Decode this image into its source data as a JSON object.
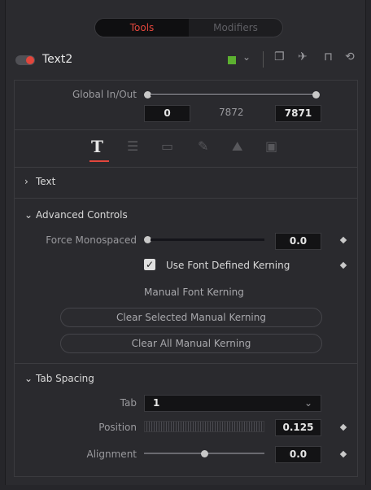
{
  "tabs": {
    "tools": "Tools",
    "modifiers": "Modifiers"
  },
  "header": {
    "tool_name": "Text2",
    "color_chip": "#5cb030"
  },
  "global": {
    "label": "Global In/Out",
    "in": "0",
    "mid": "7872",
    "out": "7871"
  },
  "icons": {
    "text_tab": "T",
    "layout_tab": "layout-icon",
    "transform_tab": "transform-icon",
    "shading_tab": "brush-icon",
    "image_tab": "image-icon",
    "settings_tab": "settings-icon"
  },
  "sections": {
    "text": "Text",
    "advanced": "Advanced Controls",
    "tab_spacing": "Tab Spacing"
  },
  "advanced": {
    "force_mono_label": "Force Monospaced",
    "force_mono_value": "0.0",
    "force_mono_fraction": 0.0,
    "kerning_checkbox_label": "Use Font Defined Kerning",
    "kerning_checked": true,
    "manual_kerning_label": "Manual Font Kerning",
    "clear_selected": "Clear Selected Manual Kerning",
    "clear_all": "Clear All Manual Kerning"
  },
  "tab_spacing": {
    "tab_label": "Tab",
    "tab_value": "1",
    "position_label": "Position",
    "position_value": "0.125",
    "alignment_label": "Alignment",
    "alignment_value": "0.0",
    "alignment_fraction": 0.5
  },
  "colors": {
    "accent": "#e2463c",
    "chip": "#5cb030"
  }
}
